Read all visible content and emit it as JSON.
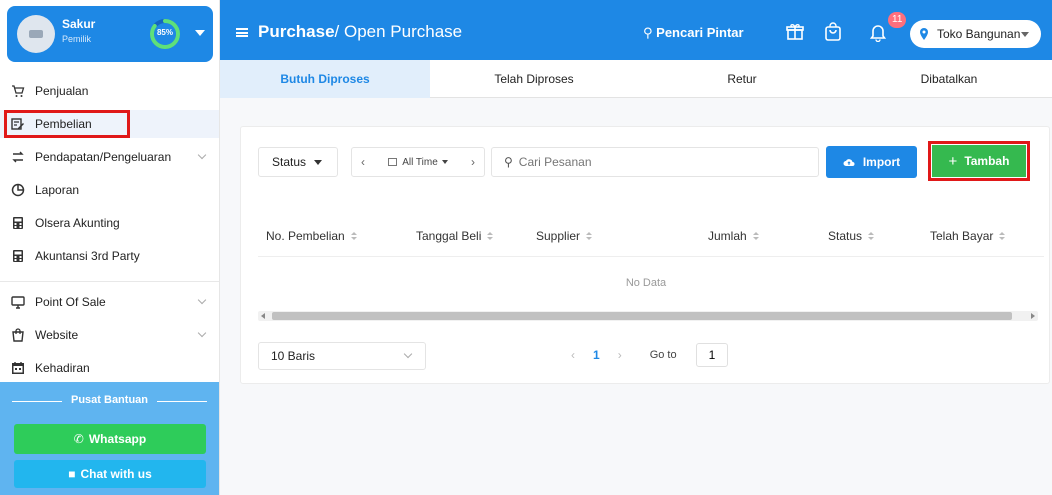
{
  "user": {
    "name": "Sakur",
    "role": "Pemilik",
    "progress_label": "85%",
    "progress": 0.85
  },
  "sidebar": {
    "items": [
      {
        "label": "Penjualan",
        "icon": "cart-icon"
      },
      {
        "label": "Pembelian",
        "icon": "purchase-icon"
      },
      {
        "label": "Pendapatan/Pengeluaran",
        "icon": "exchange-icon"
      },
      {
        "label": "Laporan",
        "icon": "report-icon"
      },
      {
        "label": "Olsera Akunting",
        "icon": "calculator-icon"
      },
      {
        "label": "Akuntansi 3rd Party",
        "icon": "calculator-icon"
      },
      {
        "label": "Point Of Sale",
        "icon": "monitor-icon"
      },
      {
        "label": "Website",
        "icon": "bag-icon"
      },
      {
        "label": "Kehadiran",
        "icon": "calendar-icon"
      }
    ]
  },
  "help": {
    "title": "Pusat Bantuan",
    "whatsapp_label": "Whatsapp",
    "chat_label": "Chat with us"
  },
  "header": {
    "crumb_main": "Purchase",
    "crumb_sub": "/ Open Purchase",
    "search_label": "Pencari Pintar",
    "notif_count": "11",
    "store_name": "Toko Bangunan"
  },
  "tabs": [
    {
      "label": "Butuh Diproses"
    },
    {
      "label": "Telah Diproses"
    },
    {
      "label": "Retur"
    },
    {
      "label": "Dibatalkan"
    }
  ],
  "toolbar": {
    "status_label": "Status",
    "range_label": "All Time",
    "search_placeholder": "Cari Pesanan",
    "import_label": "Import",
    "add_label": "Tambah"
  },
  "table": {
    "columns": [
      "No. Pembelian",
      "Tanggal Beli",
      "Supplier",
      "Jumlah",
      "Status",
      "Telah Bayar"
    ],
    "empty_text": "No Data"
  },
  "pagination": {
    "rows_label": "10 Baris",
    "current_page": "1",
    "goto_label": "Go to",
    "goto_value": "1"
  },
  "colors": {
    "primary": "#1e88e5",
    "success": "#35b94f",
    "highlight": "#e01818",
    "whatsapp": "#2ecc5a"
  }
}
